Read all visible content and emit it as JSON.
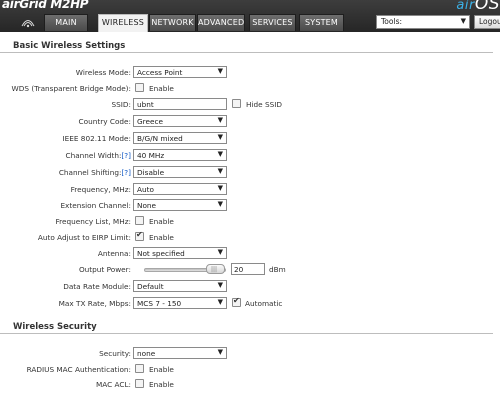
{
  "header": {
    "logo": "airGrid M2HP",
    "brand_prefix": "air",
    "brand_suffix": "OS",
    "tabs": [
      "MAIN",
      "WIRELESS",
      "NETWORK",
      "ADVANCED",
      "SERVICES",
      "SYSTEM"
    ],
    "active_tab": "WIRELESS",
    "tools_label": "Tools:",
    "logout_label": "Logout"
  },
  "basic": {
    "title": "Basic Wireless Settings",
    "wireless_mode": {
      "label": "Wireless Mode:",
      "value": "Access Point"
    },
    "wds": {
      "label": "WDS (Transparent Bridge Mode):",
      "checkbox_label": "Enable",
      "checked": false
    },
    "ssid": {
      "label": "SSID:",
      "value": "ubnt",
      "hide_label": "Hide SSID",
      "hidden": false
    },
    "country": {
      "label": "Country Code:",
      "value": "Greece"
    },
    "ieee_mode": {
      "label": "IEEE 802.11 Mode:",
      "value": "B/G/N mixed"
    },
    "channel_width": {
      "label": "Channel Width:",
      "help": "[?]",
      "value": "40 MHz"
    },
    "channel_shifting": {
      "label": "Channel Shifting:",
      "help": "[?]",
      "value": "Disable"
    },
    "frequency": {
      "label": "Frequency, MHz:",
      "value": "Auto"
    },
    "extension_channel": {
      "label": "Extension Channel:",
      "value": "None"
    },
    "frequency_list": {
      "label": "Frequency List, MHz:",
      "checkbox_label": "Enable",
      "checked": false
    },
    "auto_adjust": {
      "label": "Auto Adjust to EIRP Limit:",
      "checkbox_label": "Enable",
      "checked": true
    },
    "antenna": {
      "label": "Antenna:",
      "value": "Not specified"
    },
    "output_power": {
      "label": "Output Power:",
      "value": "20",
      "unit": "dBm",
      "level_fraction": 0.95
    },
    "data_rate_module": {
      "label": "Data Rate Module:",
      "value": "Default"
    },
    "max_tx_rate": {
      "label": "Max TX Rate, Mbps:",
      "value": "MCS 7 - 150",
      "auto_label": "Automatic",
      "auto": true
    }
  },
  "security": {
    "title": "Wireless Security",
    "security": {
      "label": "Security:",
      "value": "none"
    },
    "radius_mac": {
      "label": "RADIUS MAC Authentication:",
      "checkbox_label": "Enable",
      "checked": false
    },
    "mac_acl": {
      "label": "MAC ACL:",
      "checkbox_label": "Enable",
      "checked": false
    }
  }
}
